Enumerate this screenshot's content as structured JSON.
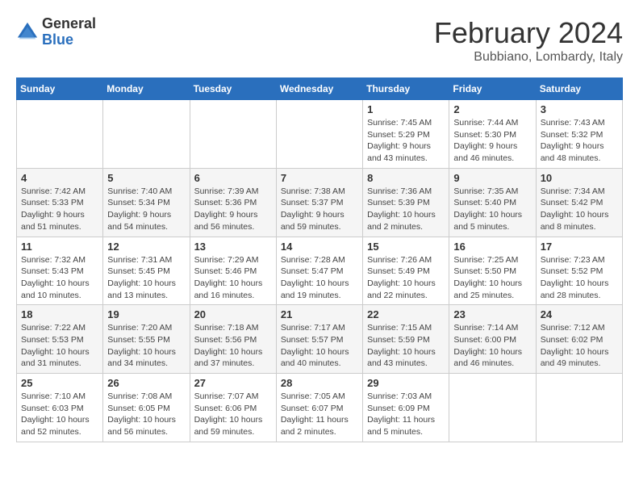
{
  "logo": {
    "line1": "General",
    "line2": "Blue"
  },
  "title": "February 2024",
  "location": "Bubbiano, Lombardy, Italy",
  "days_of_week": [
    "Sunday",
    "Monday",
    "Tuesday",
    "Wednesday",
    "Thursday",
    "Friday",
    "Saturday"
  ],
  "weeks": [
    [
      {
        "day": "",
        "info": ""
      },
      {
        "day": "",
        "info": ""
      },
      {
        "day": "",
        "info": ""
      },
      {
        "day": "",
        "info": ""
      },
      {
        "day": "1",
        "info": "Sunrise: 7:45 AM\nSunset: 5:29 PM\nDaylight: 9 hours and 43 minutes."
      },
      {
        "day": "2",
        "info": "Sunrise: 7:44 AM\nSunset: 5:30 PM\nDaylight: 9 hours and 46 minutes."
      },
      {
        "day": "3",
        "info": "Sunrise: 7:43 AM\nSunset: 5:32 PM\nDaylight: 9 hours and 48 minutes."
      }
    ],
    [
      {
        "day": "4",
        "info": "Sunrise: 7:42 AM\nSunset: 5:33 PM\nDaylight: 9 hours and 51 minutes."
      },
      {
        "day": "5",
        "info": "Sunrise: 7:40 AM\nSunset: 5:34 PM\nDaylight: 9 hours and 54 minutes."
      },
      {
        "day": "6",
        "info": "Sunrise: 7:39 AM\nSunset: 5:36 PM\nDaylight: 9 hours and 56 minutes."
      },
      {
        "day": "7",
        "info": "Sunrise: 7:38 AM\nSunset: 5:37 PM\nDaylight: 9 hours and 59 minutes."
      },
      {
        "day": "8",
        "info": "Sunrise: 7:36 AM\nSunset: 5:39 PM\nDaylight: 10 hours and 2 minutes."
      },
      {
        "day": "9",
        "info": "Sunrise: 7:35 AM\nSunset: 5:40 PM\nDaylight: 10 hours and 5 minutes."
      },
      {
        "day": "10",
        "info": "Sunrise: 7:34 AM\nSunset: 5:42 PM\nDaylight: 10 hours and 8 minutes."
      }
    ],
    [
      {
        "day": "11",
        "info": "Sunrise: 7:32 AM\nSunset: 5:43 PM\nDaylight: 10 hours and 10 minutes."
      },
      {
        "day": "12",
        "info": "Sunrise: 7:31 AM\nSunset: 5:45 PM\nDaylight: 10 hours and 13 minutes."
      },
      {
        "day": "13",
        "info": "Sunrise: 7:29 AM\nSunset: 5:46 PM\nDaylight: 10 hours and 16 minutes."
      },
      {
        "day": "14",
        "info": "Sunrise: 7:28 AM\nSunset: 5:47 PM\nDaylight: 10 hours and 19 minutes."
      },
      {
        "day": "15",
        "info": "Sunrise: 7:26 AM\nSunset: 5:49 PM\nDaylight: 10 hours and 22 minutes."
      },
      {
        "day": "16",
        "info": "Sunrise: 7:25 AM\nSunset: 5:50 PM\nDaylight: 10 hours and 25 minutes."
      },
      {
        "day": "17",
        "info": "Sunrise: 7:23 AM\nSunset: 5:52 PM\nDaylight: 10 hours and 28 minutes."
      }
    ],
    [
      {
        "day": "18",
        "info": "Sunrise: 7:22 AM\nSunset: 5:53 PM\nDaylight: 10 hours and 31 minutes."
      },
      {
        "day": "19",
        "info": "Sunrise: 7:20 AM\nSunset: 5:55 PM\nDaylight: 10 hours and 34 minutes."
      },
      {
        "day": "20",
        "info": "Sunrise: 7:18 AM\nSunset: 5:56 PM\nDaylight: 10 hours and 37 minutes."
      },
      {
        "day": "21",
        "info": "Sunrise: 7:17 AM\nSunset: 5:57 PM\nDaylight: 10 hours and 40 minutes."
      },
      {
        "day": "22",
        "info": "Sunrise: 7:15 AM\nSunset: 5:59 PM\nDaylight: 10 hours and 43 minutes."
      },
      {
        "day": "23",
        "info": "Sunrise: 7:14 AM\nSunset: 6:00 PM\nDaylight: 10 hours and 46 minutes."
      },
      {
        "day": "24",
        "info": "Sunrise: 7:12 AM\nSunset: 6:02 PM\nDaylight: 10 hours and 49 minutes."
      }
    ],
    [
      {
        "day": "25",
        "info": "Sunrise: 7:10 AM\nSunset: 6:03 PM\nDaylight: 10 hours and 52 minutes."
      },
      {
        "day": "26",
        "info": "Sunrise: 7:08 AM\nSunset: 6:05 PM\nDaylight: 10 hours and 56 minutes."
      },
      {
        "day": "27",
        "info": "Sunrise: 7:07 AM\nSunset: 6:06 PM\nDaylight: 10 hours and 59 minutes."
      },
      {
        "day": "28",
        "info": "Sunrise: 7:05 AM\nSunset: 6:07 PM\nDaylight: 11 hours and 2 minutes."
      },
      {
        "day": "29",
        "info": "Sunrise: 7:03 AM\nSunset: 6:09 PM\nDaylight: 11 hours and 5 minutes."
      },
      {
        "day": "",
        "info": ""
      },
      {
        "day": "",
        "info": ""
      }
    ]
  ]
}
